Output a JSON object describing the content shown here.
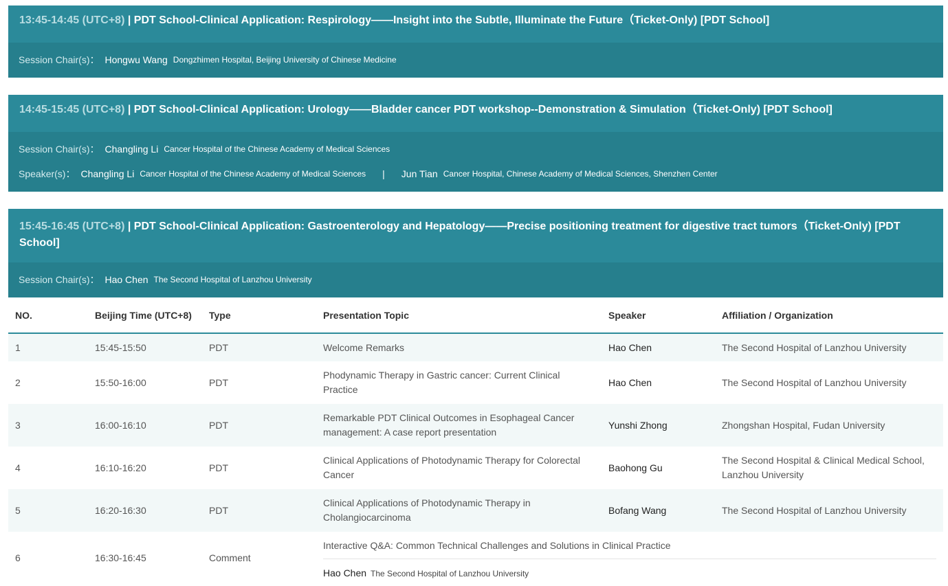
{
  "sessions": [
    {
      "time": "13:45-14:45 (UTC+8)",
      "title": " | PDT School-Clinical Application: Respirology——Insight into the Subtle, Illuminate the Future（Ticket-Only) [PDT School]",
      "chair_label": "Session Chair(s)：",
      "chair_name": "Hongwu Wang",
      "chair_aff": "Dongzhimen Hospital, Beijing University of Chinese Medicine"
    },
    {
      "time": "14:45-15:45 (UTC+8)",
      "title": " | PDT School-Clinical Application: Urology——Bladder cancer PDT workshop--Demonstration & Simulation（Ticket-Only) [PDT School]",
      "chair_label": "Session Chair(s)：",
      "chair_name": "Changling Li",
      "chair_aff": "Cancer Hospital of the Chinese Academy of Medical Sciences",
      "speaker_label": "Speaker(s)：",
      "speakers": [
        {
          "name": "Changling Li",
          "aff": "Cancer Hospital of the Chinese Academy of Medical Sciences"
        },
        {
          "name": "Jun Tian",
          "aff": "Cancer Hospital, Chinese Academy of Medical Sciences, Shenzhen Center"
        }
      ],
      "separator": "|"
    },
    {
      "time": "15:45-16:45 (UTC+8)",
      "title": " | PDT School-Clinical Application: Gastroenterology and Hepatology——Precise positioning treatment for digestive tract tumors（Ticket-Only) [PDT School]",
      "chair_label": "Session Chair(s)：",
      "chair_name": "Hao Chen",
      "chair_aff": "The Second Hospital of Lanzhou University"
    }
  ],
  "table": {
    "headers": [
      "NO.",
      "Beijing Time (UTC+8)",
      "Type",
      "Presentation Topic",
      "Speaker",
      "Affiliation / Organization"
    ],
    "rows": [
      {
        "no": "1",
        "time": "15:45-15:50",
        "type": "PDT",
        "topic": "Welcome Remarks",
        "speaker": "Hao Chen",
        "aff": "The Second Hospital of Lanzhou University"
      },
      {
        "no": "2",
        "time": "15:50-16:00",
        "type": "PDT",
        "topic": "Phodynamic Therapy in Gastric cancer: Current Clinical Practice",
        "speaker": "Hao Chen",
        "aff": "The Second Hospital of Lanzhou University"
      },
      {
        "no": "3",
        "time": "16:00-16:10",
        "type": "PDT",
        "topic": "Remarkable PDT Clinical Outcomes in Esophageal Cancer management: A case report presentation",
        "speaker": "Yunshi Zhong",
        "aff": "Zhongshan Hospital, Fudan University"
      },
      {
        "no": "4",
        "time": "16:10-16:20",
        "type": "PDT",
        "topic": "Clinical Applications of Photodynamic Therapy for Colorectal Cancer",
        "speaker": "Baohong Gu",
        "aff": "The Second Hospital & Clinical Medical School, Lanzhou University"
      },
      {
        "no": "5",
        "time": "16:20-16:30",
        "type": "PDT",
        "topic": "Clinical Applications of Photodynamic Therapy in Cholangiocarcinoma",
        "speaker": "Bofang Wang",
        "aff": "The Second Hospital of Lanzhou University"
      },
      {
        "no": "6",
        "time": "16:30-16:45",
        "type": "Comment",
        "topic": "Interactive Q&A: Common Technical Challenges and Solutions in Clinical Practice",
        "speaker": "Hao Chen",
        "aff": "The Second Hospital of Lanzhou University"
      }
    ]
  },
  "colors": {
    "header_bg": "#2b8a9a",
    "body_bg": "#267f8d",
    "time_text": "#b9dde2",
    "row_alt": "#f2f8f8"
  }
}
